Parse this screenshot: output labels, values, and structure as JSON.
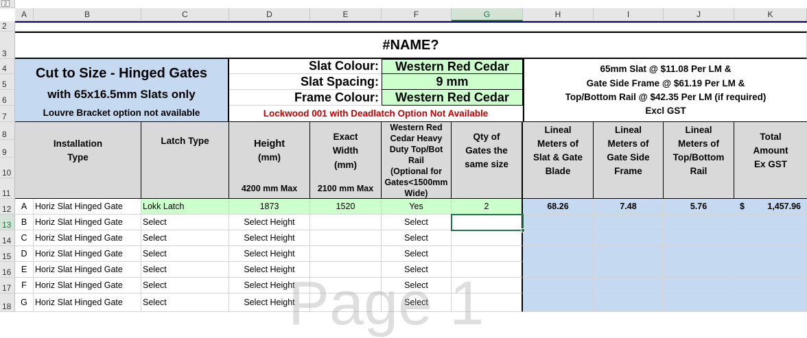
{
  "columns": [
    "A",
    "B",
    "C",
    "D",
    "E",
    "F",
    "G",
    "H",
    "I",
    "J",
    "K"
  ],
  "selected_column": "G",
  "rows": [
    "2",
    "3",
    "4",
    "5",
    "6",
    "7",
    "8",
    "9",
    "10",
    "11",
    "12",
    "13",
    "14",
    "15",
    "16",
    "17",
    "18"
  ],
  "selected_row": "13",
  "corner_level": "2",
  "title": "#NAME?",
  "intro": {
    "line1": "Cut to Size - Hinged Gates",
    "line2": "with 65x16.5mm Slats only",
    "line3": "Louvre Bracket option not available"
  },
  "spec": {
    "slat_colour_label": "Slat Colour:",
    "slat_colour_value": "Western Red Cedar",
    "slat_spacing_label": "Slat Spacing:",
    "slat_spacing_value": "9 mm",
    "frame_colour_label": "Frame Colour:",
    "frame_colour_value": "Western Red Cedar",
    "warning": "Lockwood 001 with Deadlatch Option Not Available"
  },
  "pricing": {
    "line1": "65mm Slat @ $11.08 Per LM &",
    "line2": "Gate Side Frame @ $61.19 Per LM &",
    "line3": "Top/Bottom Rail @ $42.35 Per LM (if required)",
    "line4": "Excl GST"
  },
  "headers": {
    "installation_type_1": "Installation",
    "installation_type_2": "Type",
    "latch_type": "Latch Type",
    "height_1": "Height",
    "height_2": "(mm)",
    "height_max": "4200 mm Max",
    "width_1": "Exact",
    "width_2": "Width",
    "width_3": "(mm)",
    "width_max": "2100 mm Max",
    "rail_1": "Western Red",
    "rail_2": "Cedar Heavy",
    "rail_3": "Duty Top/Bot",
    "rail_4": "Rail",
    "rail_5": "(Optional for",
    "rail_6": "Gates<1500mm",
    "rail_7": "Wide)",
    "qty_1": "Qty of",
    "qty_2": "Gates the",
    "qty_3": "same size",
    "lm_slat_1": "Lineal",
    "lm_slat_2": "Meters of",
    "lm_slat_3": "Slat & Gate",
    "lm_slat_4": "Blade",
    "lm_frame_1": "Lineal",
    "lm_frame_2": "Meters of",
    "lm_frame_3": "Gate Side",
    "lm_frame_4": "Frame",
    "lm_rail_1": "Lineal",
    "lm_rail_2": "Meters of",
    "lm_rail_3": "Top/Bottom",
    "lm_rail_4": "Rail",
    "total_1": "Total",
    "total_2": "Amount",
    "total_3": "Ex GST"
  },
  "gate_rows": [
    {
      "letter": "A",
      "type": "Horiz Slat Hinged Gate",
      "latch": "Lokk Latch",
      "height": "1873",
      "width": "1520",
      "rail": "Yes",
      "qty": "2",
      "lm_slat": "68.26",
      "lm_frame": "7.48",
      "lm_rail": "5.76",
      "currency": "$",
      "total": "1,457.96"
    },
    {
      "letter": "B",
      "type": "Horiz Slat Hinged Gate",
      "latch": "Select",
      "height": "Select Height",
      "width": "",
      "rail": "Select",
      "qty": "",
      "lm_slat": "",
      "lm_frame": "",
      "lm_rail": "",
      "currency": "",
      "total": ""
    },
    {
      "letter": "C",
      "type": "Horiz Slat Hinged Gate",
      "latch": "Select",
      "height": "Select Height",
      "width": "",
      "rail": "Select",
      "qty": "",
      "lm_slat": "",
      "lm_frame": "",
      "lm_rail": "",
      "currency": "",
      "total": ""
    },
    {
      "letter": "D",
      "type": "Horiz Slat Hinged Gate",
      "latch": "Select",
      "height": "Select Height",
      "width": "",
      "rail": "Select",
      "qty": "",
      "lm_slat": "",
      "lm_frame": "",
      "lm_rail": "",
      "currency": "",
      "total": ""
    },
    {
      "letter": "E",
      "type": "Horiz Slat Hinged Gate",
      "latch": "Select",
      "height": "Select Height",
      "width": "",
      "rail": "Select",
      "qty": "",
      "lm_slat": "",
      "lm_frame": "",
      "lm_rail": "",
      "currency": "",
      "total": ""
    },
    {
      "letter": "F",
      "type": "Horiz Slat Hinged Gate",
      "latch": "Select",
      "height": "Select Height",
      "width": "",
      "rail": "Select",
      "qty": "",
      "lm_slat": "",
      "lm_frame": "",
      "lm_rail": "",
      "currency": "",
      "total": ""
    },
    {
      "letter": "G",
      "type": "Horiz Slat Hinged Gate",
      "latch": "Select",
      "height": "Select Height",
      "width": "",
      "rail": "Select",
      "qty": "",
      "lm_slat": "",
      "lm_frame": "",
      "lm_rail": "",
      "currency": "",
      "total": ""
    }
  ],
  "watermark": "Page 1"
}
